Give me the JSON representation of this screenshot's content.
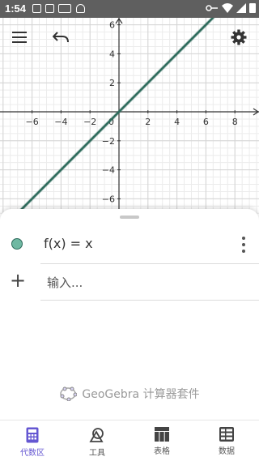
{
  "status_bar": {
    "time": "1:54"
  },
  "graph": {
    "x_axis_ticks": [
      "−6",
      "−4",
      "−2",
      "0",
      "2",
      "4",
      "6",
      "8"
    ],
    "y_axis_ticks": [
      "6",
      "4",
      "2",
      "−2",
      "−4",
      "−6"
    ],
    "axis_color": "#333333",
    "line_color": "#2e6b5c"
  },
  "algebra": {
    "expression": "f(x) = x",
    "input_placeholder": "输入..."
  },
  "branding": {
    "text": "GeoGebra 计算器套件"
  },
  "bottom_nav": {
    "tabs": [
      {
        "label": "代数区",
        "icon": "calculator-icon",
        "active": true
      },
      {
        "label": "工具",
        "icon": "shapes-tool-icon",
        "active": false
      },
      {
        "label": "表格",
        "icon": "table-icon",
        "active": false
      },
      {
        "label": "数据",
        "icon": "data-grid-icon",
        "active": false
      }
    ]
  },
  "colors": {
    "accent": "#6557d2",
    "function_dot": "#6fb8a2"
  }
}
